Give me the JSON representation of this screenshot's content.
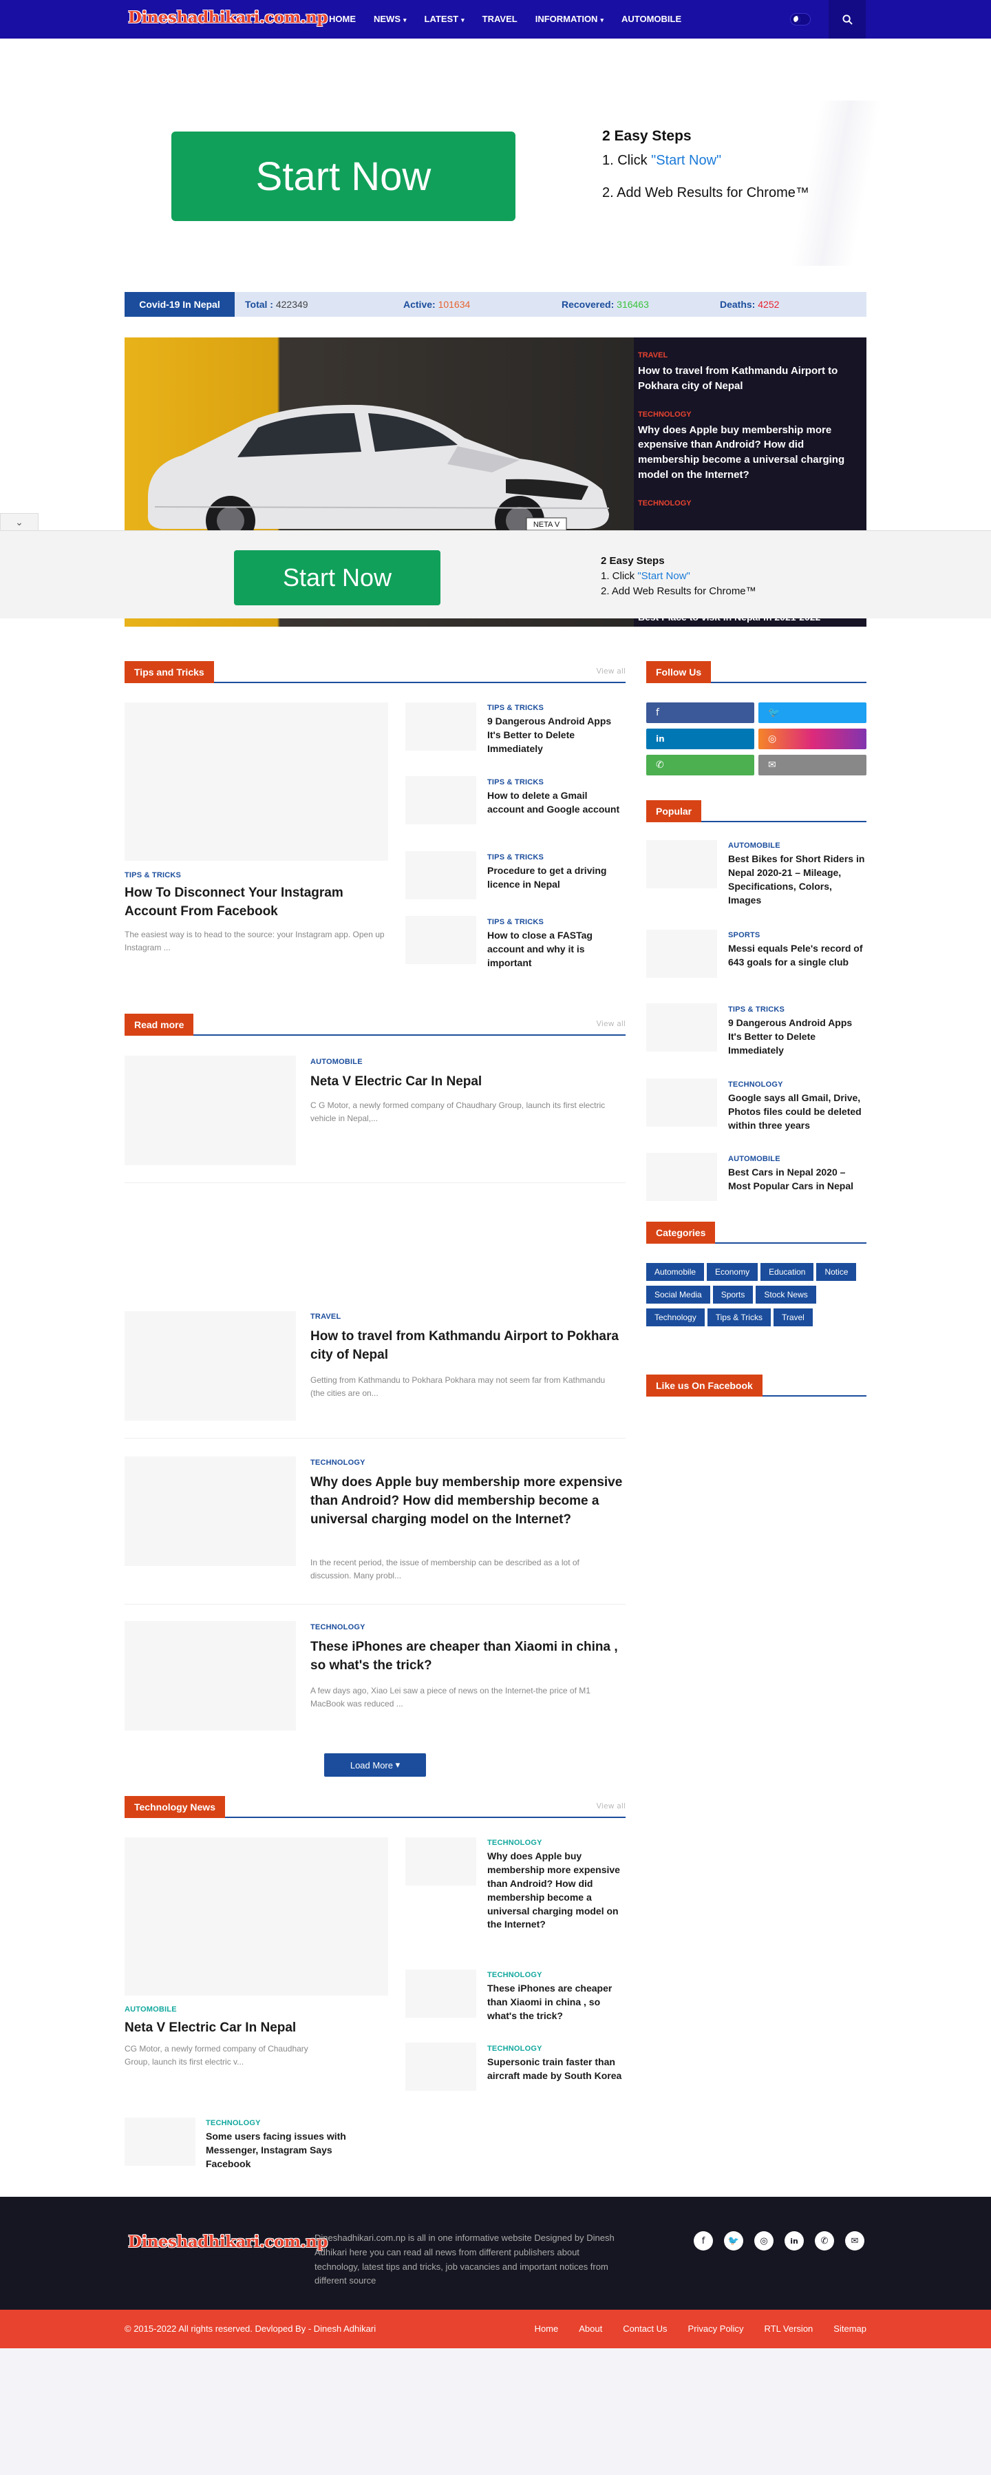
{
  "header": {
    "logo": "Dineshadhikari.com.np",
    "nav": [
      {
        "label": "HOME",
        "dropdown": false
      },
      {
        "label": "NEWS",
        "dropdown": true
      },
      {
        "label": "LATEST",
        "dropdown": true
      },
      {
        "label": "TRAVEL",
        "dropdown": false
      },
      {
        "label": "INFORMATION",
        "dropdown": true
      },
      {
        "label": "AUTOMOBILE",
        "dropdown": false
      }
    ],
    "colors": {
      "bg": "#1a0fa3",
      "accent": "#e8432f"
    }
  },
  "ad_top": {
    "button": "Start Now",
    "steps_title": "2 Easy Steps",
    "step1_prefix": "1. Click ",
    "step1_link": "\"Start Now\"",
    "step2": "2. Add Web Results for Chrome™"
  },
  "covid": {
    "label": "Covid-19 In Nepal",
    "total_label": "Total :",
    "total": "422349",
    "active_label": "Active:",
    "active": "101634",
    "recovered_label": "Recovered:",
    "recovered": "316463",
    "deaths_label": "Deaths:",
    "deaths": "4252",
    "colors": {
      "active": "#e8632f",
      "recovered": "#3bc43b",
      "deaths": "#e8232f"
    }
  },
  "hero": {
    "car_plate": "NETA V",
    "side": [
      {
        "cat": "TRAVEL",
        "title": "How to travel from Kathmandu Airport to Pokhara city of Nepal"
      },
      {
        "cat": "TECHNOLOGY",
        "title": "Why does Apple buy membership more expensive than Android? How did membership become a universal charging model on the Internet?"
      },
      {
        "cat": "TECHNOLOGY",
        "title": ""
      }
    ],
    "last": "Best Place to visit in Nepal in 2021-2022"
  },
  "ad_bottom": {
    "button": "Start Now",
    "steps_title": "2 Easy Steps",
    "step1_prefix": "1. Click ",
    "step1_link": "\"Start Now\"",
    "step2": "2. Add Web Results for Chrome™"
  },
  "tips": {
    "heading": "Tips and Tricks",
    "view_all": "View all",
    "main": {
      "cat": "TIPS & TRICKS",
      "title": "How To Disconnect Your Instagram Account From Facebook",
      "excerpt": "The easiest way is to head to the source: your Instagram app. Open up Instagram ..."
    },
    "list": [
      {
        "cat": "TIPS & TRICKS",
        "title": "9 Dangerous Android Apps It's Better to Delete Immediately"
      },
      {
        "cat": "TIPS & TRICKS",
        "title": "How to delete a Gmail account and Google account"
      },
      {
        "cat": "TIPS & TRICKS",
        "title": "Procedure to get a driving licence in Nepal"
      },
      {
        "cat": "TIPS & TRICKS",
        "title": "How to close a FASTag account and why it is important"
      }
    ]
  },
  "readmore": {
    "heading": "Read more",
    "view_all": "View all",
    "items": [
      {
        "cat": "AUTOMOBILE",
        "title": "Neta V Electric Car In Nepal",
        "excerpt": "C G Motor, a newly formed company of Chaudhary Group, launch its first electric vehicle in Nepal,..."
      },
      {
        "cat": "TRAVEL",
        "title": "How to travel from Kathmandu Airport to Pokhara city of Nepal",
        "excerpt": "Getting from Kathmandu to Pokhara Pokhara may not seem far from Kathmandu (the cities are on..."
      },
      {
        "cat": "TECHNOLOGY",
        "title": "Why does Apple buy membership more expensive than Android? How did membership become a universal charging model on the Internet?",
        "excerpt": "In the recent period, the issue of membership can be described as a lot of discussion. Many probl..."
      },
      {
        "cat": "TECHNOLOGY",
        "title": "These iPhones are cheaper than Xiaomi in china , so what's the trick?",
        "excerpt": "A few days ago, Xiao Lei saw a piece of news on the Internet-the price of M1 MacBook was reduced ..."
      }
    ],
    "load_more": "Load More"
  },
  "technews": {
    "heading": "Technology News",
    "view_all": "View all",
    "main": {
      "cat": "AUTOMOBILE",
      "title": "Neta V Electric Car In Nepal",
      "excerpt": "CG Motor, a newly formed company of Chaudhary Group, launch its first electric v..."
    },
    "list": [
      {
        "cat": "TECHNOLOGY",
        "title": "Why does Apple buy membership more expensive than Android? How did membership become a universal charging model on the Internet?"
      },
      {
        "cat": "TECHNOLOGY",
        "title": "These iPhones are cheaper than Xiaomi in china , so what's the trick?"
      },
      {
        "cat": "TECHNOLOGY",
        "title": "Supersonic train faster than aircraft made by South Korea"
      }
    ],
    "extra": {
      "cat": "TECHNOLOGY",
      "title": "Some users facing issues with Messenger, Instagram Says Facebook"
    }
  },
  "sidebar": {
    "follow": "Follow Us",
    "social": [
      {
        "icon": "facebook-icon",
        "glyph": "f",
        "color": "#3b5998"
      },
      {
        "icon": "twitter-icon",
        "glyph": "🐦",
        "color": "#1da1f2"
      },
      {
        "icon": "linkedin-icon",
        "glyph": "in",
        "color": "#0077b5"
      },
      {
        "icon": "instagram-icon",
        "glyph": "◎",
        "color": "#e1306c"
      },
      {
        "icon": "whatsapp-icon",
        "glyph": "✆",
        "color": "#4caf50"
      },
      {
        "icon": "email-icon",
        "glyph": "✉",
        "color": "#888888"
      }
    ],
    "popular_heading": "Popular",
    "popular": [
      {
        "cat": "AUTOMOBILE",
        "title": "Best Bikes for Short Riders in Nepal 2020-21 – Mileage, Specifications, Colors, Images"
      },
      {
        "cat": "SPORTS",
        "title": "Messi equals Pele's record of 643 goals for a single club"
      },
      {
        "cat": "TIPS & TRICKS",
        "title": "9 Dangerous Android Apps It's Better to Delete Immediately"
      },
      {
        "cat": "TECHNOLOGY",
        "title": "Google says all Gmail, Drive, Photos files could be deleted within three years"
      },
      {
        "cat": "AUTOMOBILE",
        "title": "Best Cars in Nepal 2020 – Most Popular Cars in Nepal"
      }
    ],
    "categories_heading": "Categories",
    "categories": [
      "Automobile",
      "Economy",
      "Education",
      "Notice",
      "Social Media",
      "Sports",
      "Stock News",
      "Technology",
      "Tips & Tricks",
      "Travel"
    ],
    "like_heading": "Like us On Facebook"
  },
  "footer": {
    "logo": "Dineshadhikari.com.np",
    "about": "Dineshadhikari.com.np is all in one informative website Designed by Dinesh Adhikari here you can read all news from different publishers about technology, latest tips and tricks, job vacancies and important notices from different source",
    "icons": [
      "facebook-icon",
      "twitter-icon",
      "instagram-icon",
      "linkedin-icon",
      "whatsapp-icon",
      "email-icon"
    ],
    "copyright": "© 2015-2022 All rights reserved. Devloped By - Dinesh Adhikari",
    "links": [
      "Home",
      "About",
      "Contact Us",
      "Privacy Policy",
      "RTL Version",
      "Sitemap"
    ]
  }
}
